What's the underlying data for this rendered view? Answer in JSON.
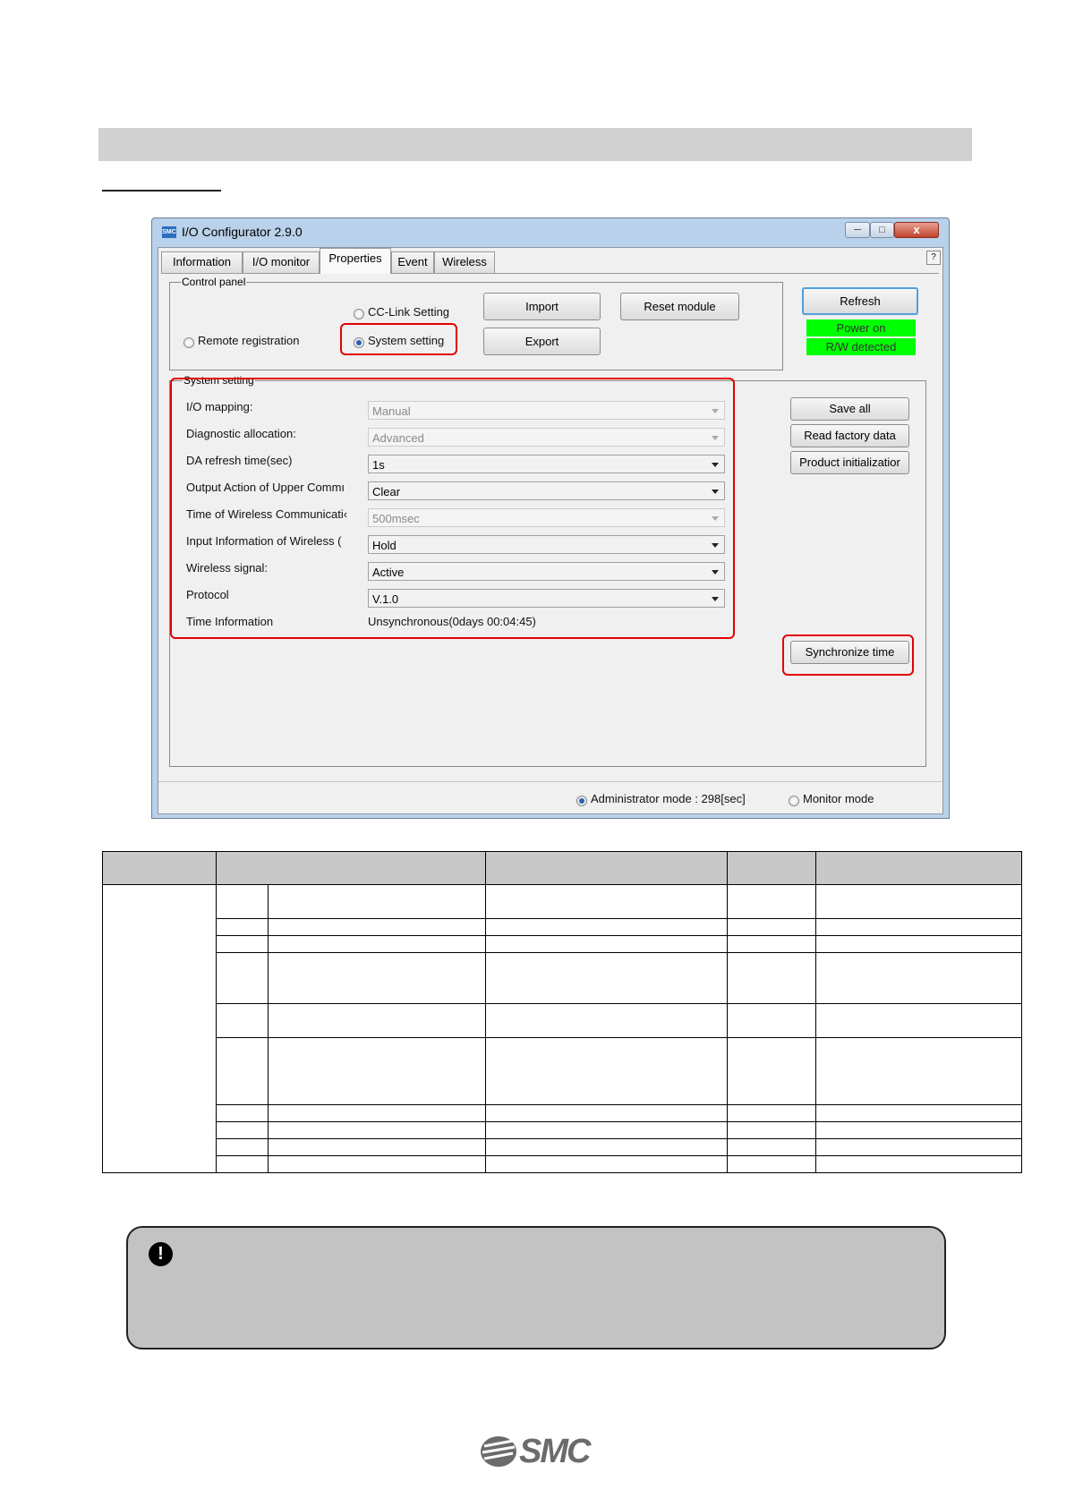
{
  "window": {
    "title": "I/O Configurator 2.9.0",
    "app_icon_text": "SMC",
    "help_label": "?",
    "close_label": "x"
  },
  "tabs": [
    {
      "label": "Information"
    },
    {
      "label": "I/O monitor"
    },
    {
      "label": "Properties"
    },
    {
      "label": "Event"
    },
    {
      "label": "Wireless"
    }
  ],
  "control_panel": {
    "legend": "Control panel",
    "cc_link_label": "CC-Link Setting",
    "remote_registration_label": "Remote registration",
    "system_setting_label": "System setting",
    "import_label": "Import",
    "export_label": "Export",
    "reset_module_label": "Reset module",
    "refresh_label": "Refresh",
    "status_power": "Power on",
    "status_rw": "R/W detected",
    "status_color": "#00ff00"
  },
  "system_setting": {
    "legend": "System setting",
    "rows": [
      {
        "label": "I/O mapping:",
        "value": "Manual"
      },
      {
        "label": "Diagnostic allocation:",
        "value": "Advanced"
      },
      {
        "label": "DA refresh time(sec)",
        "value": "1s"
      },
      {
        "label": "Output Action of Upper Commı",
        "value": "Clear"
      },
      {
        "label": "Time of Wireless Communicati‹",
        "value": "500msec"
      },
      {
        "label": "Input Information of Wireless (",
        "value": "Hold"
      },
      {
        "label": "Wireless signal:",
        "value": "Active"
      },
      {
        "label": "Protocol",
        "value": "V.1.0"
      }
    ],
    "time_label": "Time Information",
    "time_value": "Unsynchronous(0days 00:04:45)",
    "save_all_label": "Save all",
    "read_factory_label": "Read factory data",
    "product_init_label": "Product initializatior",
    "sync_time_label": "Synchronize time"
  },
  "status_bar": {
    "admin_mode": "Administrator mode : 298[sec]",
    "monitor_mode": "Monitor mode"
  },
  "caution": {
    "icon_text": "!"
  },
  "logo": {
    "text": "SMC",
    "registered_mark": "."
  },
  "highlight_color": "#e30000"
}
